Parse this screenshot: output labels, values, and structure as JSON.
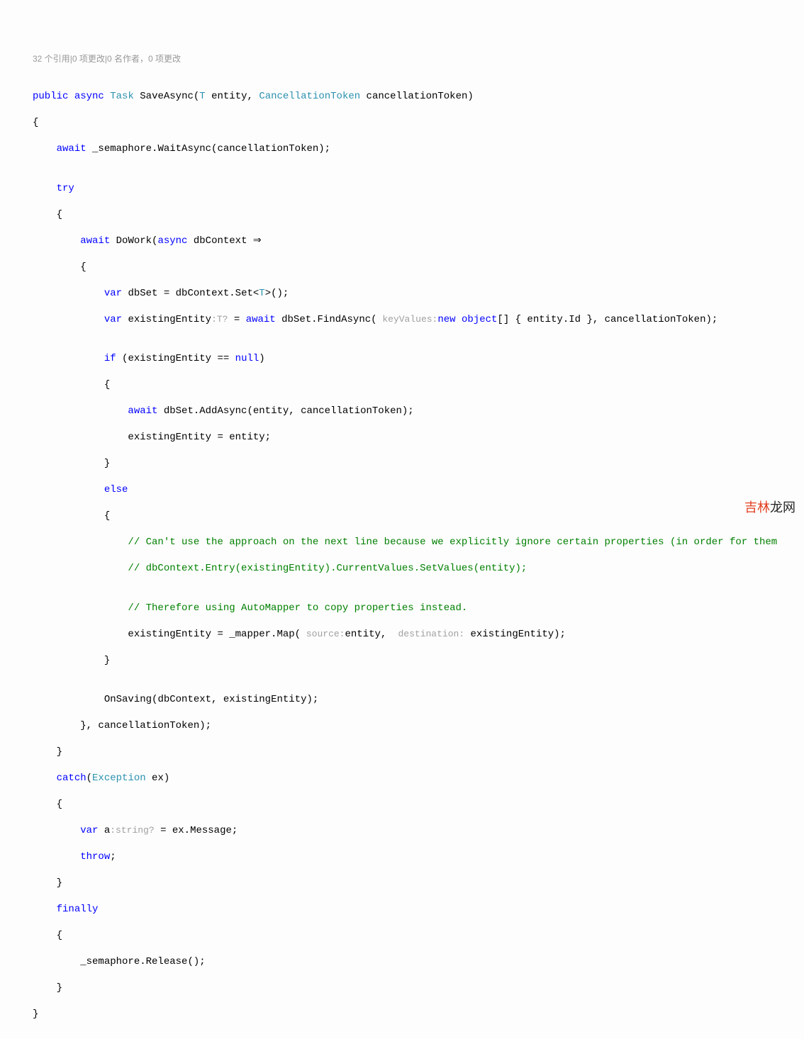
{
  "codelens": {
    "refs": "32 个引用",
    "sep1": "|",
    "changes1": "0 项更改",
    "sep2": "|",
    "authors": "0 名作者，",
    "changes2": "0 项更改"
  },
  "sig": {
    "public": "public",
    "async": "async",
    "task": "Task",
    "name": "SaveAsync",
    "lparen": "(",
    "T": "T",
    "entity": " entity, ",
    "ctType": "CancellationToken",
    "ctName": " cancellationToken)"
  },
  "l": {
    "obrace": "{",
    "await1a": "await",
    "await1b": " _semaphore.WaitAsync(cancellationToken);",
    "try": "try",
    "obrace2": "{",
    "await2a": "await",
    "await2b": " DoWork(",
    "await2c": "async",
    "await2d": " dbContext ⇒",
    "obrace3": "{",
    "var1a": "var",
    "var1b": " dbSet = dbContext.Set<",
    "var1c": "T",
    "var1d": ">();",
    "var2a": "var",
    "var2b": " existingEntity",
    "var2hint": ":T?",
    "var2c": " = ",
    "var2d": "await",
    "var2e": " dbSet.FindAsync(",
    "var2hint2": " keyValues:",
    "var2f": "new",
    "var2g": " ",
    "var2h": "object",
    "var2i": "[] { entity.Id }, cancellationToken);",
    "if1a": "if",
    "if1b": " (existingEntity == ",
    "if1c": "null",
    "if1d": ")",
    "obrace4": "{",
    "add1a": "await",
    "add1b": " dbSet.AddAsync(entity, cancellationToken);",
    "assign1": "existingEntity = entity;",
    "cbrace4": "}",
    "else": "else",
    "obrace5": "{",
    "cmt1": "// Can't use the approach on the next line because we explicitly ignore certain properties (in order for them",
    "cmt2": "// dbContext.Entry(existingEntity).CurrentValues.SetValues(entity);",
    "cmt3": "// Therefore using AutoMapper to copy properties instead.",
    "map1a": "existingEntity = _mapper.Map(",
    "map1h1": " source:",
    "map1b": "entity, ",
    "map1h2": " destination:",
    "map1c": " existingEntity);",
    "cbrace5": "}",
    "onsave": "OnSaving(dbContext, existingEntity);",
    "cbrace3": "}, cancellationToken);",
    "cbrace2": "}",
    "catch1a": "catch",
    "catch1b": "(",
    "catch1c": "Exception",
    "catch1d": " ex)",
    "obrace6": "{",
    "exmsg1a": "var",
    "exmsg1b": " a",
    "exmsg1h": ":string?",
    "exmsg1c": " = ex.Message;",
    "throw": "throw",
    "throwsemi": ";",
    "cbrace6": "}",
    "finally": "finally",
    "obrace7": "{",
    "release": "_semaphore.Release();",
    "cbrace7": "}",
    "cbraceEnd": "}"
  },
  "watermark": {
    "part1": "吉林",
    "part2": "龙网"
  }
}
